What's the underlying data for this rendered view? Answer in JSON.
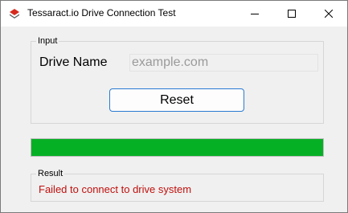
{
  "window": {
    "title": "Tessaract.io Drive Connection Test",
    "app_icon": "tessaract-logo-icon",
    "controls": [
      "minimize-icon",
      "maximize-icon",
      "close-icon"
    ]
  },
  "input_group": {
    "legend": "Input",
    "drive_label": "Drive Name",
    "drive_value": "",
    "drive_placeholder": "example.com",
    "reset_label": "Reset"
  },
  "progress": {
    "value": 1.0,
    "color": "#06b025"
  },
  "result_group": {
    "legend": "Result",
    "message": "Failed to connect to drive system",
    "message_color": "#c0100d"
  }
}
